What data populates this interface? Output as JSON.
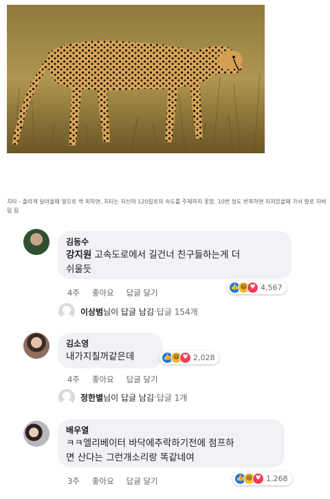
{
  "caption": "치타 - 졸라게 달려올때 옆으로 싹 피하면, 치타는 자신의 120킬로의 속도를 주체하지 못함. 10번 정도 반복하면 지쳐있을때 가서 발로 차버림 됨",
  "comments": [
    {
      "author": "김동수",
      "tagged": "강지원",
      "text_line1": " 고속도로에서 길건너 친구들하는게 더",
      "text_line2": "쉬울듯",
      "time": "4주",
      "like_label": "좋아요",
      "reply_label": "답글 달기",
      "reaction_count": "4,567",
      "reply": {
        "name": "이상범",
        "suffix": "님이 답글 남김",
        "dot": " · ",
        "count": "답글 154개"
      }
    },
    {
      "author": "김소영",
      "text": "내가지칠꺼같은데",
      "time": "4주",
      "like_label": "좋아요",
      "reply_label": "답글 달기",
      "reaction_count": "2,028",
      "reply": {
        "name": "정한별",
        "suffix": "님이 답글 남김",
        "dot": " · ",
        "count": "답글 1개"
      }
    },
    {
      "author": "배우열",
      "text_line1": "ㅋㅋ엘리베이터 바닥에추락하기전에 점프하",
      "text_line2": "면 산다는 그런개소리랑 똑같네여",
      "time": "3주",
      "like_label": "좋아요",
      "reply_label": "답글 달기",
      "reaction_count": "1,268"
    }
  ],
  "icons": {
    "like": "thumbs-up-icon",
    "haha": "laughing-face-icon",
    "love": "heart-icon",
    "reply_arrow": "reply-arrow-icon"
  },
  "colors": {
    "like": "#1877f2",
    "haha": "#f7b928",
    "love": "#f33e58",
    "bubble": "#f0f2f5",
    "muted": "#65676b"
  }
}
